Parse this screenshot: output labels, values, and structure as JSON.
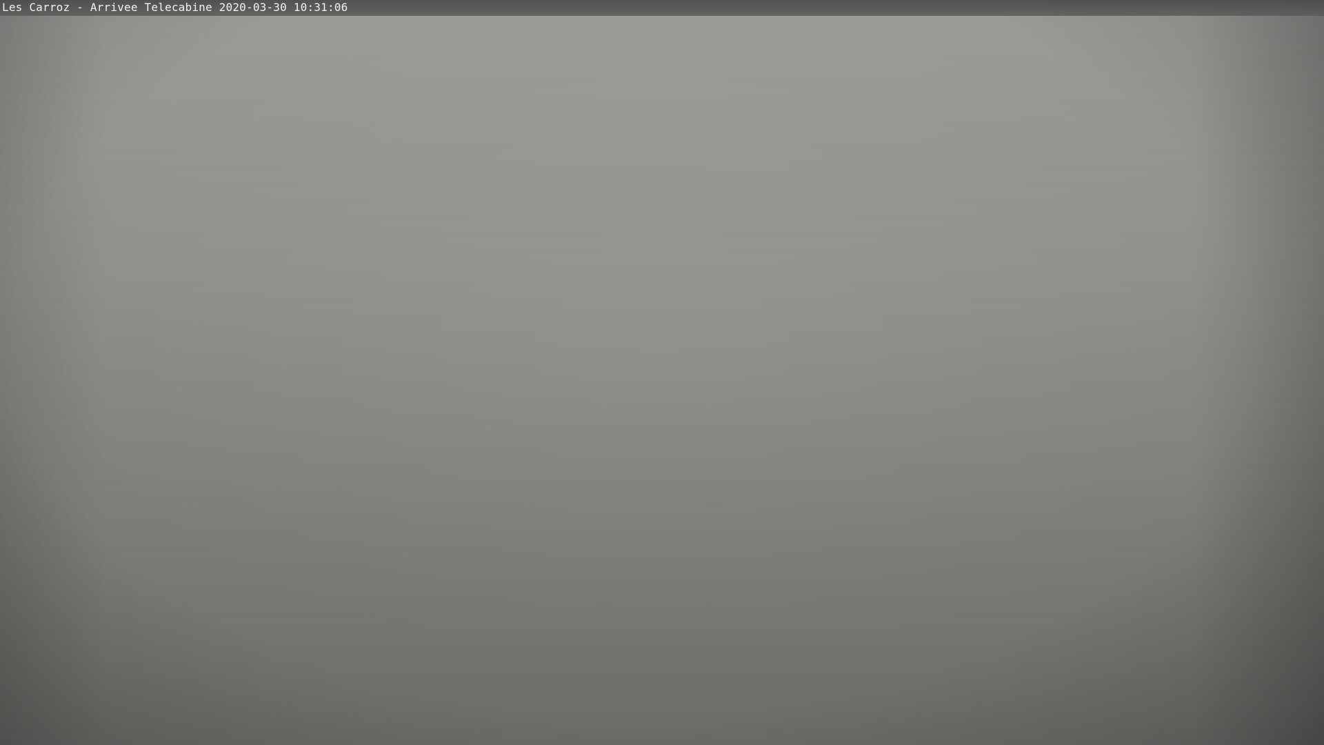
{
  "overlay": {
    "caption": "Les Carroz - Arrivee Telecabine 2020-03-30 10:31:06"
  },
  "scene": {
    "colors": {
      "fog_top": "#9b9c98",
      "fog_mid": "#8f908b",
      "fog_bottom": "#6b6c68",
      "caption_bar": "#4b4c49",
      "caption_text": "#f2f2f2"
    }
  }
}
